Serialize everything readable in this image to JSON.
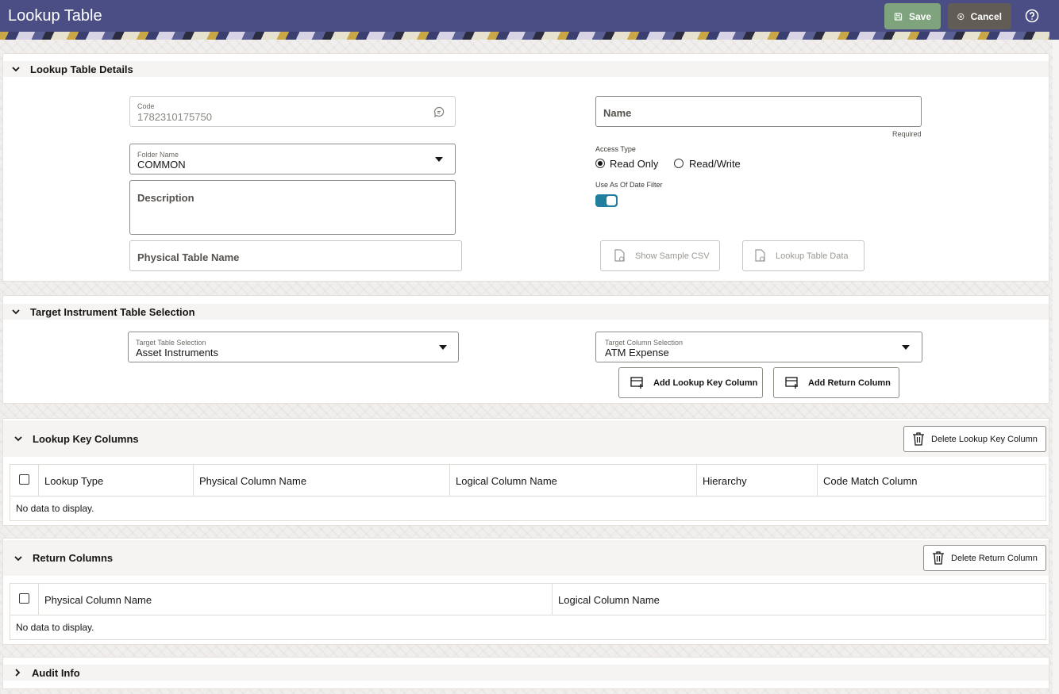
{
  "header": {
    "title": "Lookup Table",
    "save_label": "Save",
    "cancel_label": "Cancel"
  },
  "details": {
    "title": "Lookup Table Details",
    "code_label": "Code",
    "code_value": "1782310175750",
    "name_placeholder": "Name",
    "required_label": "Required",
    "folder_label": "Folder Name",
    "folder_value": "COMMON",
    "description_placeholder": "Description",
    "physical_table_placeholder": "Physical Table Name",
    "access_type_label": "Access Type",
    "access_options": [
      "Read Only",
      "Read/Write"
    ],
    "access_selected": "Read Only",
    "date_filter_label": "Use As Of Date Filter",
    "date_filter_on": true,
    "show_csv_label": "Show Sample CSV",
    "lookup_data_label": "Lookup Table Data"
  },
  "target": {
    "title": "Target Instrument Table Selection",
    "table_label": "Target Table Selection",
    "table_value": "Asset Instruments",
    "column_label": "Target Column Selection",
    "column_value": "ATM Expense",
    "add_key_label": "Add Lookup Key Column",
    "add_return_label": "Add Return Column"
  },
  "key_columns": {
    "title": "Lookup Key Columns",
    "delete_label": "Delete Lookup Key Column",
    "headers": [
      "Lookup Type",
      "Physical Column Name",
      "Logical Column Name",
      "Hierarchy",
      "Code Match Column"
    ],
    "empty": "No data to display."
  },
  "return_columns": {
    "title": "Return Columns",
    "delete_label": "Delete Return Column",
    "headers": [
      "Physical Column Name",
      "Logical Column Name"
    ],
    "empty": "No data to display."
  },
  "audit": {
    "title": "Audit Info"
  },
  "colors": {
    "header_bg": "#4a4e85",
    "save_bg": "#7ea37d",
    "cancel_bg": "#615c55",
    "toggle_on": "#227e9e"
  }
}
